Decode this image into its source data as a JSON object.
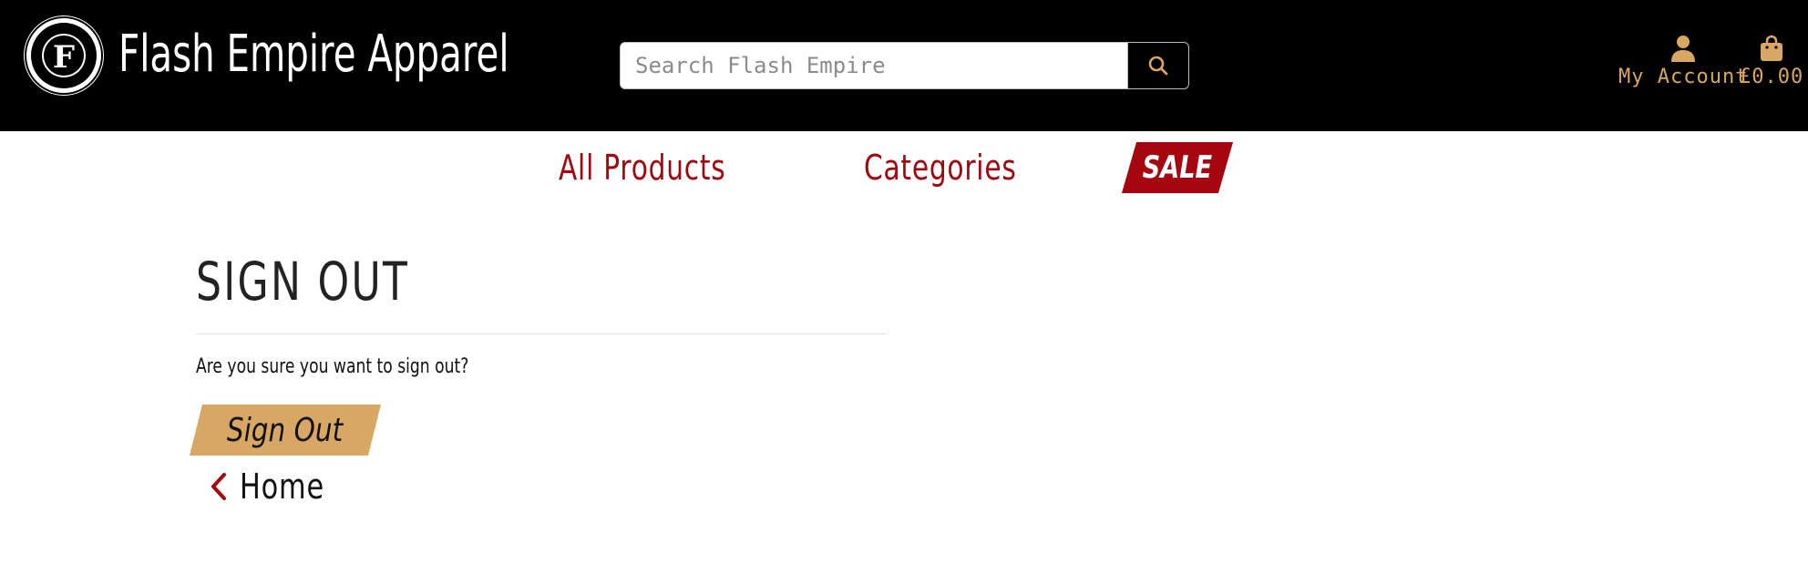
{
  "header": {
    "brand": "Flash Empire Apparel",
    "logo_letter": "F",
    "logo_ring_text": "FLASH EMPIRE APPAREL",
    "search": {
      "placeholder": "Search Flash Empire",
      "value": "",
      "icon": "search-icon"
    },
    "account": {
      "label": "My Account",
      "icon": "user-icon"
    },
    "cart": {
      "total": "£0.00",
      "icon": "shopping-bag-icon"
    }
  },
  "nav": {
    "items": [
      {
        "label": "All Products"
      },
      {
        "label": "Categories"
      },
      {
        "label": "SALE"
      }
    ]
  },
  "main": {
    "title": "SIGN OUT",
    "question": "Are you sure you want to sign out?",
    "signout_label": "Sign Out",
    "home_label": "Home",
    "home_icon": "chevron-left-icon"
  },
  "colors": {
    "header_bg": "#000000",
    "accent_gold": "#d7a763",
    "brand_red": "#a5060f",
    "text_dark": "#222222"
  }
}
